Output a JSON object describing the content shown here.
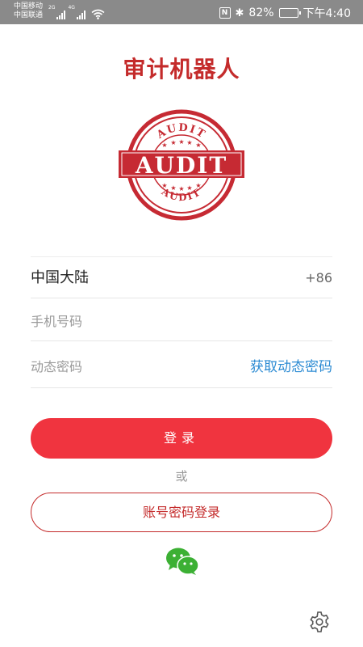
{
  "status_bar": {
    "carrier_1": "中国移动",
    "carrier_2": "中国联通",
    "net_1": "2G",
    "net_2": "4G",
    "nfc": "N",
    "battery_percent": "82%",
    "battery_level": 0.82,
    "time": "下午4:40",
    "icons": [
      "signal-icon",
      "wifi-icon",
      "nfc-icon",
      "bluetooth-icon",
      "battery-icon"
    ]
  },
  "app": {
    "title": "审计机器人",
    "logo": {
      "name": "audit-stamp-logo",
      "text_main": "AUDIT",
      "text_top": "AUDIT",
      "text_bottom": "AUDIT",
      "color": "#c62a33"
    }
  },
  "form": {
    "region_label": "中国大陆",
    "country_code": "+86",
    "phone_placeholder": "手机号码",
    "phone_value": "",
    "code_placeholder": "动态密码",
    "code_value": "",
    "get_code_label": "获取动态密码"
  },
  "actions": {
    "login_label": "登录",
    "or_text": "或",
    "password_login_label": "账号密码登录"
  },
  "icons": {
    "wechat": "wechat-icon",
    "settings": "gear-icon"
  },
  "colors": {
    "brand_red": "#c42b2b",
    "login_button": "#f0343f",
    "link_blue": "#2c8bd3",
    "wechat_green": "#3cb034"
  }
}
